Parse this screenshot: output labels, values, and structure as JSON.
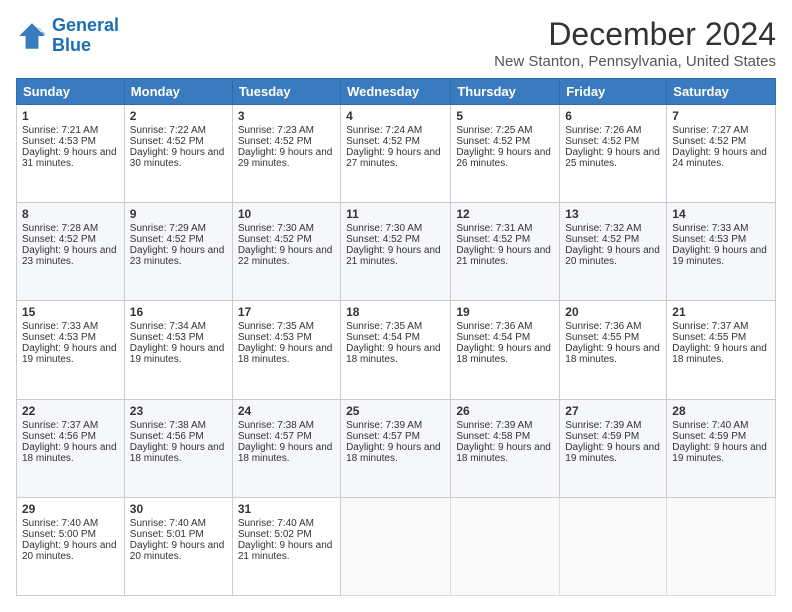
{
  "logo": {
    "line1": "General",
    "line2": "Blue"
  },
  "title": "December 2024",
  "location": "New Stanton, Pennsylvania, United States",
  "days_of_week": [
    "Sunday",
    "Monday",
    "Tuesday",
    "Wednesday",
    "Thursday",
    "Friday",
    "Saturday"
  ],
  "weeks": [
    [
      {
        "day": "1",
        "sunrise": "7:21 AM",
        "sunset": "4:53 PM",
        "daylight": "9 hours and 31 minutes."
      },
      {
        "day": "2",
        "sunrise": "7:22 AM",
        "sunset": "4:52 PM",
        "daylight": "9 hours and 30 minutes."
      },
      {
        "day": "3",
        "sunrise": "7:23 AM",
        "sunset": "4:52 PM",
        "daylight": "9 hours and 29 minutes."
      },
      {
        "day": "4",
        "sunrise": "7:24 AM",
        "sunset": "4:52 PM",
        "daylight": "9 hours and 27 minutes."
      },
      {
        "day": "5",
        "sunrise": "7:25 AM",
        "sunset": "4:52 PM",
        "daylight": "9 hours and 26 minutes."
      },
      {
        "day": "6",
        "sunrise": "7:26 AM",
        "sunset": "4:52 PM",
        "daylight": "9 hours and 25 minutes."
      },
      {
        "day": "7",
        "sunrise": "7:27 AM",
        "sunset": "4:52 PM",
        "daylight": "9 hours and 24 minutes."
      }
    ],
    [
      {
        "day": "8",
        "sunrise": "7:28 AM",
        "sunset": "4:52 PM",
        "daylight": "9 hours and 23 minutes."
      },
      {
        "day": "9",
        "sunrise": "7:29 AM",
        "sunset": "4:52 PM",
        "daylight": "9 hours and 23 minutes."
      },
      {
        "day": "10",
        "sunrise": "7:30 AM",
        "sunset": "4:52 PM",
        "daylight": "9 hours and 22 minutes."
      },
      {
        "day": "11",
        "sunrise": "7:30 AM",
        "sunset": "4:52 PM",
        "daylight": "9 hours and 21 minutes."
      },
      {
        "day": "12",
        "sunrise": "7:31 AM",
        "sunset": "4:52 PM",
        "daylight": "9 hours and 21 minutes."
      },
      {
        "day": "13",
        "sunrise": "7:32 AM",
        "sunset": "4:52 PM",
        "daylight": "9 hours and 20 minutes."
      },
      {
        "day": "14",
        "sunrise": "7:33 AM",
        "sunset": "4:53 PM",
        "daylight": "9 hours and 19 minutes."
      }
    ],
    [
      {
        "day": "15",
        "sunrise": "7:33 AM",
        "sunset": "4:53 PM",
        "daylight": "9 hours and 19 minutes."
      },
      {
        "day": "16",
        "sunrise": "7:34 AM",
        "sunset": "4:53 PM",
        "daylight": "9 hours and 19 minutes."
      },
      {
        "day": "17",
        "sunrise": "7:35 AM",
        "sunset": "4:53 PM",
        "daylight": "9 hours and 18 minutes."
      },
      {
        "day": "18",
        "sunrise": "7:35 AM",
        "sunset": "4:54 PM",
        "daylight": "9 hours and 18 minutes."
      },
      {
        "day": "19",
        "sunrise": "7:36 AM",
        "sunset": "4:54 PM",
        "daylight": "9 hours and 18 minutes."
      },
      {
        "day": "20",
        "sunrise": "7:36 AM",
        "sunset": "4:55 PM",
        "daylight": "9 hours and 18 minutes."
      },
      {
        "day": "21",
        "sunrise": "7:37 AM",
        "sunset": "4:55 PM",
        "daylight": "9 hours and 18 minutes."
      }
    ],
    [
      {
        "day": "22",
        "sunrise": "7:37 AM",
        "sunset": "4:56 PM",
        "daylight": "9 hours and 18 minutes."
      },
      {
        "day": "23",
        "sunrise": "7:38 AM",
        "sunset": "4:56 PM",
        "daylight": "9 hours and 18 minutes."
      },
      {
        "day": "24",
        "sunrise": "7:38 AM",
        "sunset": "4:57 PM",
        "daylight": "9 hours and 18 minutes."
      },
      {
        "day": "25",
        "sunrise": "7:39 AM",
        "sunset": "4:57 PM",
        "daylight": "9 hours and 18 minutes."
      },
      {
        "day": "26",
        "sunrise": "7:39 AM",
        "sunset": "4:58 PM",
        "daylight": "9 hours and 18 minutes."
      },
      {
        "day": "27",
        "sunrise": "7:39 AM",
        "sunset": "4:59 PM",
        "daylight": "9 hours and 19 minutes."
      },
      {
        "day": "28",
        "sunrise": "7:40 AM",
        "sunset": "4:59 PM",
        "daylight": "9 hours and 19 minutes."
      }
    ],
    [
      {
        "day": "29",
        "sunrise": "7:40 AM",
        "sunset": "5:00 PM",
        "daylight": "9 hours and 20 minutes."
      },
      {
        "day": "30",
        "sunrise": "7:40 AM",
        "sunset": "5:01 PM",
        "daylight": "9 hours and 20 minutes."
      },
      {
        "day": "31",
        "sunrise": "7:40 AM",
        "sunset": "5:02 PM",
        "daylight": "9 hours and 21 minutes."
      },
      null,
      null,
      null,
      null
    ]
  ],
  "labels": {
    "sunrise_prefix": "Sunrise: ",
    "sunset_prefix": "Sunset: ",
    "daylight_prefix": "Daylight: "
  }
}
